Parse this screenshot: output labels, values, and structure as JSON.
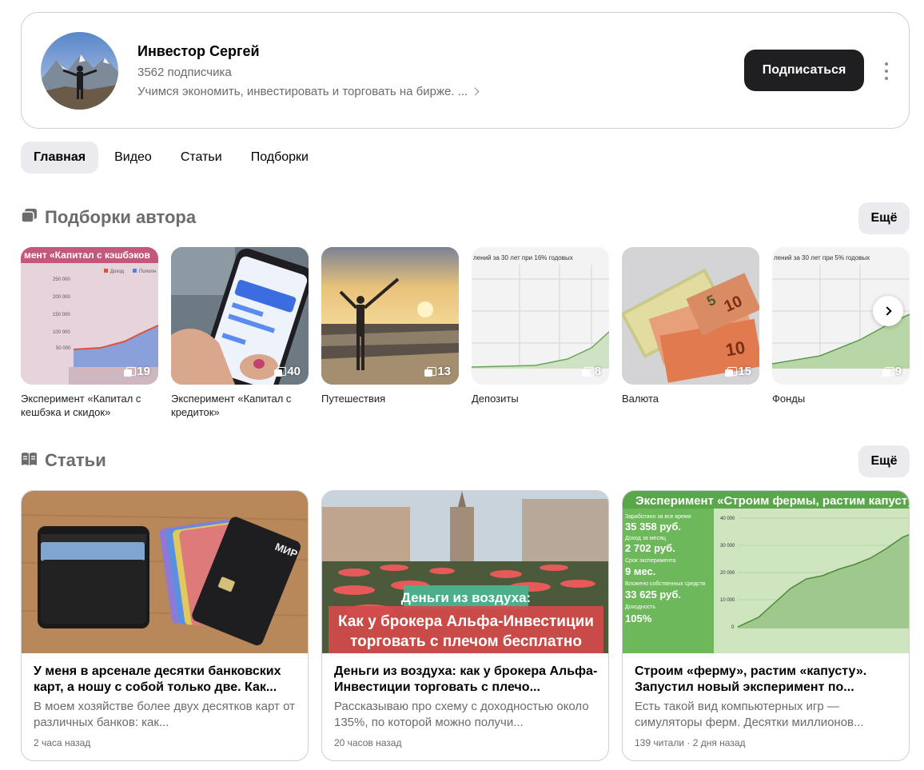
{
  "channel": {
    "name": "Инвестор Сергей",
    "subscribers": "3562 подписчика",
    "description": "Учимся экономить, инвестировать и торговать на бирже. ...",
    "subscribe_label": "Подписаться"
  },
  "tabs": [
    {
      "label": "Главная",
      "active": true
    },
    {
      "label": "Видео",
      "active": false
    },
    {
      "label": "Статьи",
      "active": false
    },
    {
      "label": "Подборки",
      "active": false
    }
  ],
  "collections_section": {
    "title": "Подборки автора",
    "more_label": "Ещё",
    "items": [
      {
        "title": "Эксперимент «Капитал с кешбэка и скидок»",
        "count": "19",
        "thumb_text": "мент «Капитал с кэшбэков"
      },
      {
        "title": "Эксперимент «Капитал с кредиток»",
        "count": "40"
      },
      {
        "title": "Путешествия",
        "count": "13"
      },
      {
        "title": "Депозиты",
        "count": "8",
        "thumb_text": "лений за 30 лет при 16% годовых"
      },
      {
        "title": "Валюта",
        "count": "15"
      },
      {
        "title": "Фонды",
        "count": "9",
        "thumb_text": "лений за 30 лет при 5% годовых"
      }
    ]
  },
  "articles_section": {
    "title": "Статьи",
    "more_label": "Ещё",
    "items": [
      {
        "title": "У меня в арсенале десятки банковских карт, а ношу с собой только две. Как...",
        "snippet": "В моем хозяйстве более двух десятков карт от различных банков: как...",
        "meta": "2 часа назад"
      },
      {
        "title": "Деньги из воздуха: как у брокера Альфа-Инвестиции торговать с плечо...",
        "snippet": "Рассказываю про схему с доходностью около 135%, по которой можно получи...",
        "meta": "20 часов назад",
        "overlay_line1": "Деньги из воздуха:",
        "overlay_line2": "Как у брокера Альфа-Инвестиции",
        "overlay_line3": "торговать с плечом бесплатно"
      },
      {
        "title": "Строим «ферму», растим «капусту». Запустил новый эксперимент по...",
        "snippet": "Есть такой вид компьютерных игр — симуляторы ферм. Десятки миллионов...",
        "meta": "139 читали · 2 дня назад",
        "banner": "Эксперимент «Строим фермы, растим капусту",
        "stats": [
          "Заработано за все время",
          "35 358 руб.",
          "Доход за месяц",
          "2 702 руб.",
          "Срок эксперимента",
          "9 мес.",
          "Вложено собственных средств",
          "33 625 руб.",
          "Доходность",
          "105%"
        ]
      }
    ]
  }
}
